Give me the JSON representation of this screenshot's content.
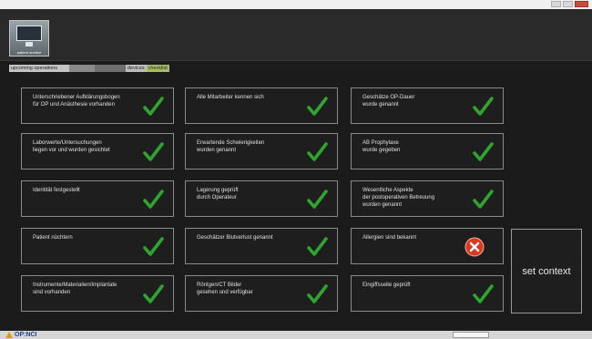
{
  "app": {
    "icon_label": "patient monitor"
  },
  "tabs": [
    {
      "label": "upcoming operations"
    },
    {
      "label": ""
    },
    {
      "label": ""
    },
    {
      "label": "devices"
    },
    {
      "label": "checklist"
    }
  ],
  "checklist": [
    {
      "text": "Unterschriebener Aufklärungsbogen\nfür OP und Anästhesie vorhanden",
      "status": "checked"
    },
    {
      "text": "Alle Mitarbeiter kennen sich",
      "status": "checked"
    },
    {
      "text": "Geschätze OP-Dauer\nwurde genannt",
      "status": "checked"
    },
    {
      "text": "Laborwerte/Untersuchungen\nliegen vor und wurden gesichtet",
      "status": "checked"
    },
    {
      "text": "Erwartende Schwierigkeiten\nwurden genannt",
      "status": "checked"
    },
    {
      "text": "AB Prophylaxe\nwurde gegeben",
      "status": "checked"
    },
    {
      "text": "Identität festgestellt",
      "status": "checked"
    },
    {
      "text": "Lagerung geprüft\ndurch Operateur",
      "status": "checked"
    },
    {
      "text": "Wesentliche Aspekte\nder postoperativen Betreuung\nwurden genannt",
      "status": "checked"
    },
    {
      "text": "Patient nüchtern",
      "status": "checked"
    },
    {
      "text": "Geschätzer Blutverlust genannt",
      "status": "checked"
    },
    {
      "text": "Allergien sind bekannt",
      "status": "failed"
    },
    {
      "text": "Instrumente/Materialien/Implantate\nsind vorhanden",
      "status": "checked"
    },
    {
      "text": "Röntgen/CT Bilder\ngesehen und verfügbar",
      "status": "checked"
    },
    {
      "text": "Eingiffsseite geprüft",
      "status": "checked"
    }
  ],
  "context_button": {
    "label": "set context"
  },
  "footer": {
    "logo_text": "OP:NCI"
  },
  "colors": {
    "check": "#2fa52f",
    "fail": "#d93a1f",
    "active_tab": "#a7b96a"
  }
}
